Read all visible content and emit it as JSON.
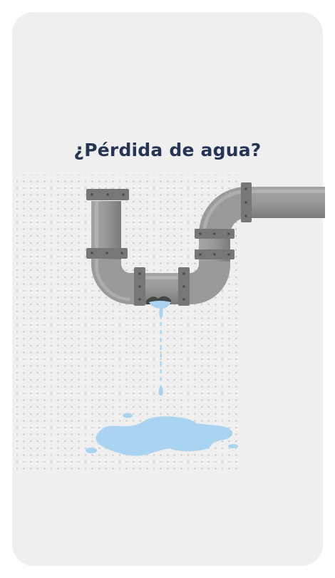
{
  "heading": "¿Pérdida de agua?",
  "illustration": {
    "subject": "leaking-pipe",
    "icons": [
      "pipe-icon",
      "water-drop-icon",
      "water-puddle-icon"
    ]
  },
  "colors": {
    "card_background": "#efefef",
    "heading": "#263553",
    "pipe": "#9b9b9b",
    "pipe_dark": "#6f6f6f",
    "water": "#a9d3f0"
  }
}
